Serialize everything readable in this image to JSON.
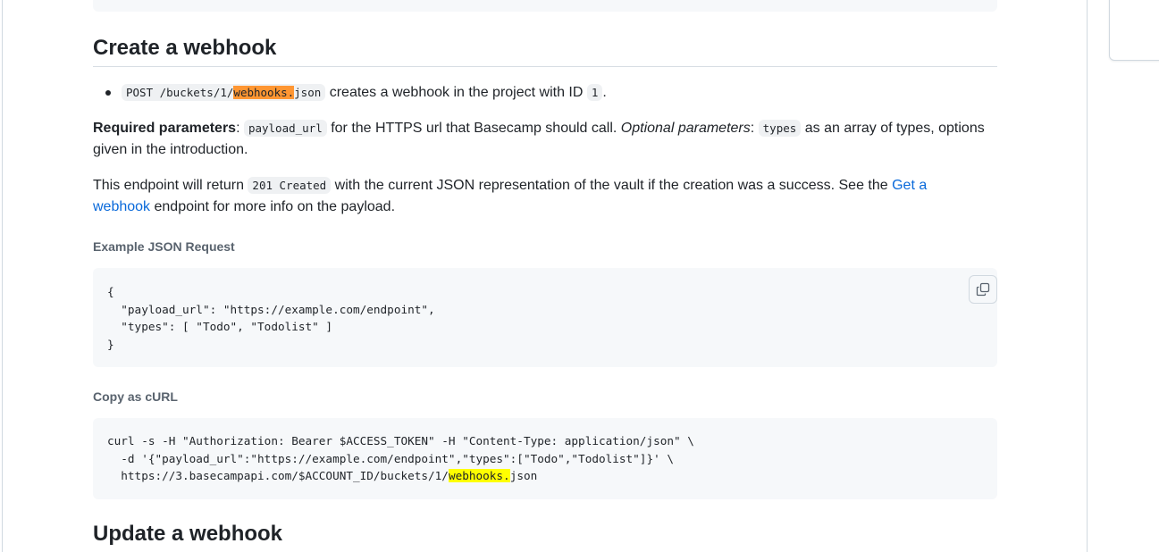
{
  "section": {
    "heading": "Create a webhook",
    "bullet": {
      "endpoint_pre": "POST /buckets/1/",
      "endpoint_match": "webhooks.",
      "endpoint_post": "json",
      "text_middle": " creates a webhook in the project with ID ",
      "id": "1",
      "text_end": "."
    },
    "required": {
      "label": "Required parameters",
      "colon": ": ",
      "param": "payload_url",
      "after_param": " for the HTTPS url that Basecamp should call. ",
      "optional_label": "Optional parameters",
      "optional_colon": ": ",
      "optional_param": "types",
      "after_optional": " as an array of types, options given in the introduction."
    },
    "returns": {
      "pre": "This endpoint will return ",
      "code": "201 Created",
      "mid": " with the current JSON representation of the vault if the creation was a success. See the ",
      "link": "Get a webhook",
      "post": " endpoint for more info on the payload."
    },
    "example_label": "Example JSON Request",
    "example_code": "{\n  \"payload_url\": \"https://example.com/endpoint\",\n  \"types\": [ \"Todo\", \"Todolist\" ]\n}",
    "curl_label": "Copy as cURL",
    "curl_line1": "curl -s -H \"Authorization: Bearer $ACCESS_TOKEN\" -H \"Content-Type: application/json\" \\",
    "curl_line2": "  -d '{\"payload_url\":\"https://example.com/endpoint\",\"types\":[\"Todo\",\"Todolist\"]}' \\",
    "curl_line3_pre": "  https://3.basecampapi.com/$ACCOUNT_ID/buckets/1/",
    "curl_line3_match": "webhooks.",
    "curl_line3_post": "json"
  },
  "next_section": {
    "heading": "Update a webhook"
  },
  "colors": {
    "link": "#0969da",
    "active_match": "#ff9632",
    "match": "#ffff00"
  },
  "icons": {
    "copy": "copy-icon"
  }
}
